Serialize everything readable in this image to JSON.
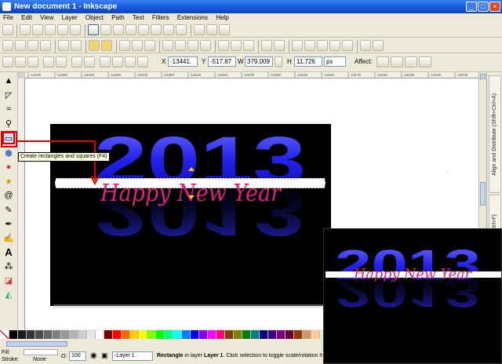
{
  "window": {
    "title": "New document 1 - Inkscape",
    "minimize": "_",
    "maximize": "□",
    "close": "×"
  },
  "menu": [
    "File",
    "Edit",
    "View",
    "Layer",
    "Object",
    "Path",
    "Text",
    "Filters",
    "Extensions",
    "Help"
  ],
  "controls": {
    "x_label": "X",
    "x_value": "-13441.",
    "y_label": "Y",
    "y_value": "-517.87",
    "w_label": "W",
    "w_value": "379.009",
    "h_label": "H",
    "h_value": "11.726",
    "unit": "px",
    "affect_label": "Affect:"
  },
  "ruler_ticks": [
    "-13475",
    "-13450",
    "-13425",
    "-13400",
    "-13375",
    "-13350",
    "-13325",
    "-13300",
    "-13275",
    "-13250",
    "-13225",
    "-13200",
    "-13175",
    "-13150",
    "-13125",
    "-13100",
    "-13075"
  ],
  "tooltip": "Create rectangles and squares (F4)",
  "artwork": {
    "year": "2013",
    "script": "Happy New Year"
  },
  "dock_tabs": [
    "Align and Distribute (Shift+Ctrl+A)",
    "Fill and Stroke (Shift+Ctrl+F)"
  ],
  "palette_colors": [
    "#000000",
    "#1a1a1a",
    "#333333",
    "#4d4d4d",
    "#666666",
    "#808080",
    "#999999",
    "#b3b3b3",
    "#cccccc",
    "#e6e6e6",
    "#ffffff",
    "#800000",
    "#ff0000",
    "#ff6600",
    "#ffcc00",
    "#ffff00",
    "#80ff00",
    "#00ff00",
    "#00ff80",
    "#00ffff",
    "#0080ff",
    "#0000ff",
    "#8000ff",
    "#ff00ff",
    "#ff0080",
    "#804000",
    "#808000",
    "#008000",
    "#008080",
    "#000080",
    "#400080",
    "#800080",
    "#660033",
    "#993300",
    "#cc9966",
    "#ffcc99"
  ],
  "status": {
    "fill_label": "Fill:",
    "stroke_label": "Stroke:",
    "stroke_value": "None",
    "opacity_label": "O:",
    "opacity_value": "100",
    "layer": "-Layer 1",
    "message_bold": "Rectangle",
    "message_mid": " in layer ",
    "message_layer": "Layer 1",
    "message_rest": ". Click selection to toggle scale/rotation h"
  },
  "colors": {
    "accent_blue": "#2222ee",
    "script_pink": "#e0207a",
    "highlight_red": "#e00000"
  }
}
